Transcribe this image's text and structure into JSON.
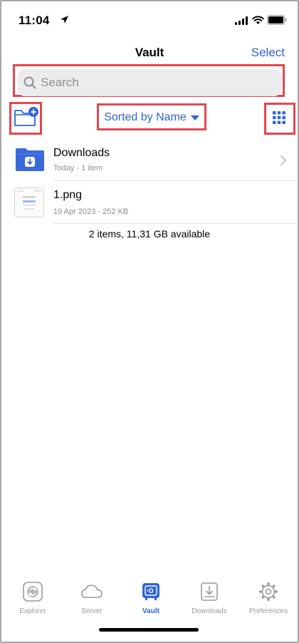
{
  "status_bar": {
    "time": "11:04"
  },
  "nav": {
    "title": "Vault",
    "select_label": "Select"
  },
  "search": {
    "placeholder": "Search"
  },
  "toolbar": {
    "sort_label": "Sorted by Name"
  },
  "files": [
    {
      "name": "Downloads",
      "meta": "Today - 1 item",
      "icon": "folder-download-icon"
    },
    {
      "name": "1.png",
      "meta": "19 Apr 2023 - 252 KB",
      "icon": "image-thumbnail"
    }
  ],
  "summary": "2 items, 11,31 GB available",
  "tabs": [
    {
      "label": "Explorer",
      "icon": "explorer-icon"
    },
    {
      "label": "Server",
      "icon": "cloud-icon"
    },
    {
      "label": "Vault",
      "icon": "vault-icon"
    },
    {
      "label": "Downloads",
      "icon": "download-tray-icon"
    },
    {
      "label": "Preferences",
      "icon": "gear-icon"
    }
  ],
  "colors": {
    "accent": "#2f63d8",
    "highlight": "#e2474f",
    "inactive": "#9a9aa0"
  }
}
